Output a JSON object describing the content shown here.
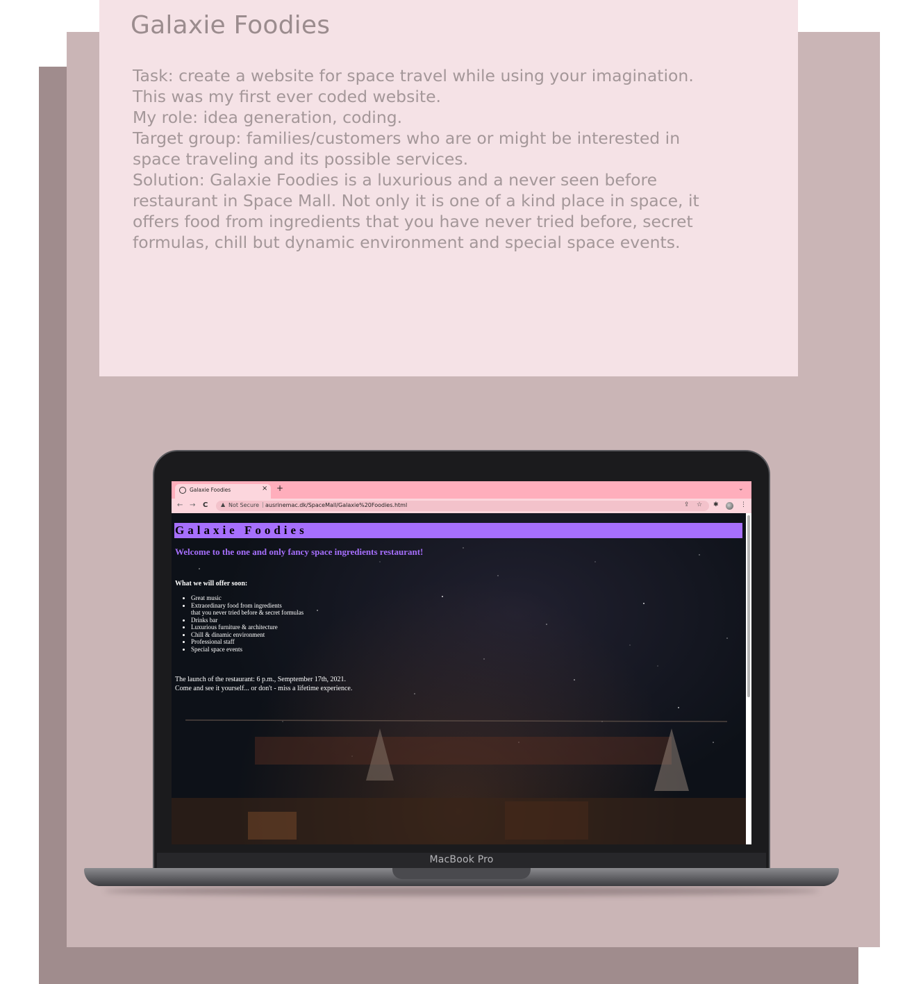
{
  "card": {
    "title": "Galaxie Foodies",
    "lines": [
      "Task: create a website for space travel while using your imagination.",
      "This was my first ever coded website.",
      "My role: idea generation, coding.",
      "Target group: families/customers who are or might be interested in",
      "space traveling and its possible services.",
      "Solution: Galaxie Foodies is a luxurious and a never seen before",
      "restaurant in Space Mall. Not only it is one of a kind place in space, it",
      "offers food from ingredients that you have never tried before, secret",
      "formulas, chill but dynamic environment and special space events."
    ]
  },
  "laptop": {
    "brand": "MacBook Pro"
  },
  "browser": {
    "tab_title": "Galaxie Foodies",
    "tab_close": "×",
    "new_tab": "+",
    "tab_menu": "⌄",
    "back": "←",
    "forward": "→",
    "reload": "C",
    "security_label": "Not Secure",
    "url": "ausrinemac.dk/SpaceMall/Galaxie%20Foodies.html"
  },
  "site": {
    "heading": "Galaxie Foodies",
    "welcome": "Welcome to the one and only fancy space ingredients restaurant!",
    "offer_heading": "What we will offer soon:",
    "offers": [
      "Great music",
      "Extraordinary food from ingredients",
      "that you never tried before & secret formulas",
      "Drinks bar",
      "Luxurious furniture & architecture",
      "Chill & dinamic environment",
      "Professional staff",
      "Special space events"
    ],
    "launch_line1": "The launch of the restaurant: 6 p.m., Semptember 17th, 2021.",
    "launch_line2": "Come and see it yourself... or don't - miss a lifetime experience."
  },
  "colors": {
    "card_bg": "#f5e2e6",
    "accent_purple": "#a66ffd",
    "tabbar_pink": "#ffaebc"
  }
}
